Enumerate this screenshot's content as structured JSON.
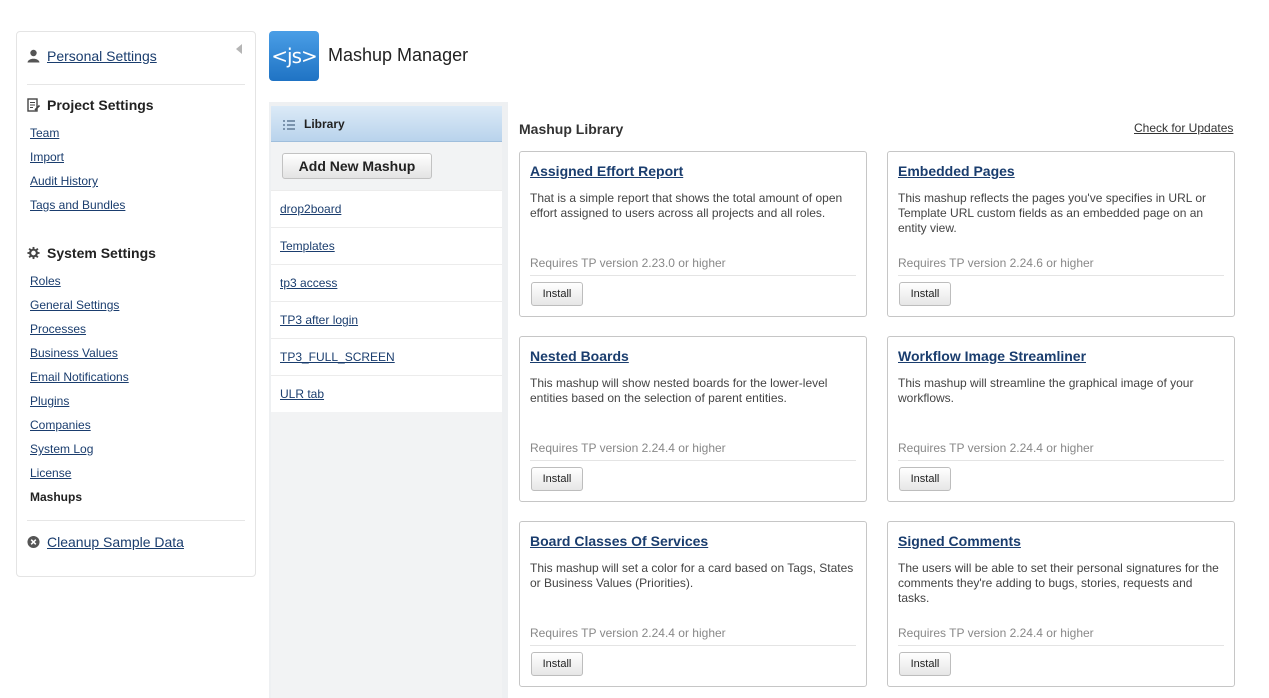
{
  "settings": {
    "personal_label": "Personal Settings",
    "project": {
      "title": "Project Settings",
      "items": [
        {
          "label": "Team"
        },
        {
          "label": "Import"
        },
        {
          "label": "Audit History"
        },
        {
          "label": "Tags and Bundles"
        }
      ]
    },
    "system": {
      "title": "System Settings",
      "items": [
        {
          "label": "Roles"
        },
        {
          "label": "General Settings"
        },
        {
          "label": "Processes"
        },
        {
          "label": "Business Values"
        },
        {
          "label": "Email Notifications"
        },
        {
          "label": "Plugins"
        },
        {
          "label": "Companies"
        },
        {
          "label": "System Log"
        },
        {
          "label": "License"
        },
        {
          "label": "Mashups"
        }
      ]
    },
    "cleanup_label": "Cleanup Sample Data"
  },
  "header": {
    "logo_text": "<js>",
    "title": "Mashup Manager"
  },
  "library": {
    "tab_label": "Library",
    "add_button": "Add New Mashup",
    "items": [
      "drop2board",
      "Templates",
      "tp3 access",
      "TP3 after login",
      "TP3_FULL_SCREEN",
      "ULR tab"
    ]
  },
  "mashup_library": {
    "title": "Mashup Library",
    "check_updates": "Check for Updates",
    "install_label": "Install",
    "cards": [
      {
        "title": "Assigned Effort Report",
        "description": "That is a simple report that shows the total amount of open effort assigned to users across all projects and all roles.",
        "requirement": "Requires TP version 2.23.0 or higher"
      },
      {
        "title": "Embedded Pages",
        "description": "This mashup reflects the pages you've specifies in URL or Template URL custom fields as an embedded page on an entity view.",
        "requirement": "Requires TP version 2.24.6 or higher"
      },
      {
        "title": "Nested Boards",
        "description": "This mashup will show nested boards for the lower-level entities based on the selection of parent entities.",
        "requirement": "Requires TP version 2.24.4 or higher"
      },
      {
        "title": "Workflow Image Streamliner",
        "description": "This mashup will streamline the graphical image of your workflows.",
        "requirement": "Requires TP version 2.24.4 or higher"
      },
      {
        "title": "Board Classes Of Services",
        "description": "This mashup will set a color for a card based on Tags, States or Business Values (Priorities).",
        "requirement": "Requires TP version 2.24.4 or higher"
      },
      {
        "title": "Signed Comments",
        "description": "The users will be able to set their personal signatures for the comments they're adding to bugs, stories, requests and tasks.",
        "requirement": "Requires TP version 2.24.4 or higher"
      }
    ]
  }
}
